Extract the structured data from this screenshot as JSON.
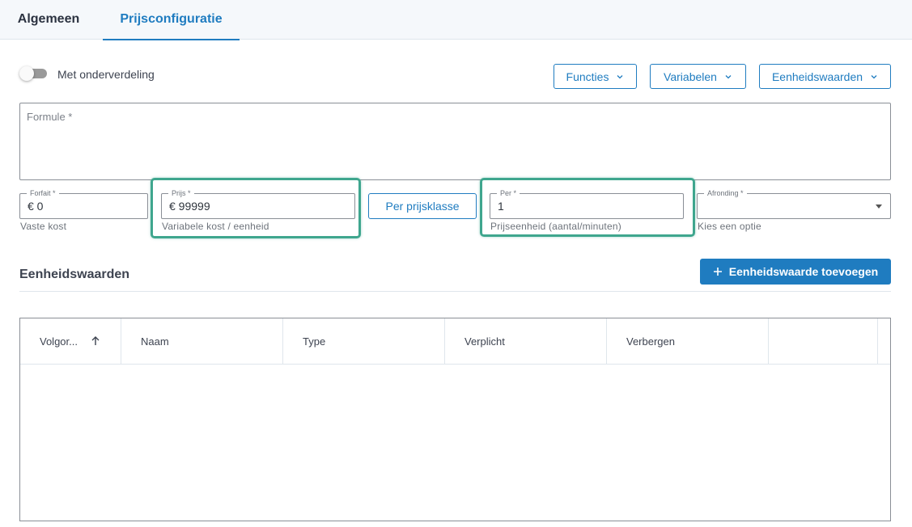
{
  "tabs": [
    {
      "label": "Algemeen",
      "active": false
    },
    {
      "label": "Prijsconfiguratie",
      "active": true
    }
  ],
  "toggle": {
    "label": "Met onderverdeling",
    "on": false
  },
  "menus": {
    "functies": "Functies",
    "variabelen": "Variabelen",
    "eenheidswaarden": "Eenheidswaarden"
  },
  "formule": {
    "label": "Formule *",
    "value": ""
  },
  "fields": {
    "forfait": {
      "label": "Forfait *",
      "value": "€ 0",
      "helper": "Vaste kost"
    },
    "prijs": {
      "label": "Prijs *",
      "value": "€ 99999",
      "helper": "Variabele kost / eenheid"
    },
    "per_prijsklasse": "Per prijsklasse",
    "per": {
      "label": "Per *",
      "value": "1",
      "helper": "Prijseenheid (aantal/minuten)"
    },
    "afronding": {
      "label": "Afronding *",
      "value": "",
      "helper": "Kies een optie"
    }
  },
  "eenheidswaarden": {
    "title": "Eenheidswaarden",
    "add_label": "Eenheidswaarde toevoegen",
    "columns": [
      "Volgor...",
      "Naam",
      "Type",
      "Verplicht",
      "Verbergen"
    ],
    "rows": []
  },
  "colors": {
    "primary": "#1f7cc0",
    "highlight": "#3fa68e"
  }
}
